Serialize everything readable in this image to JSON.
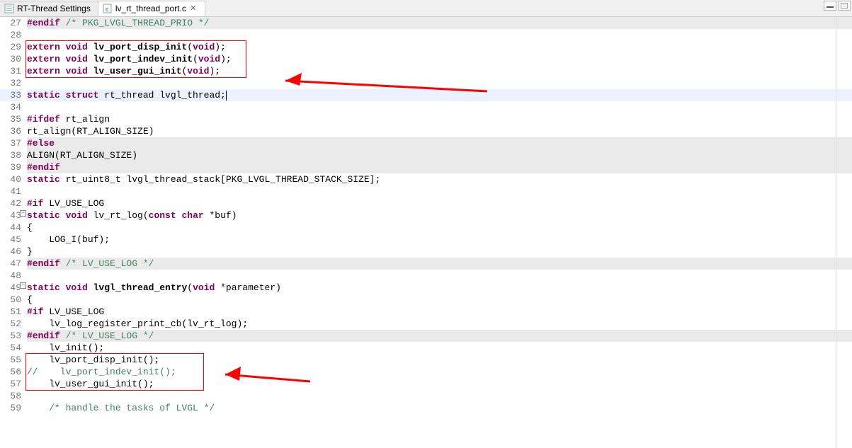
{
  "tabs": {
    "t0": {
      "label": "RT-Thread Settings"
    },
    "t1": {
      "label": "lv_rt_thread_port.c"
    }
  },
  "lineNumbers": [
    "27",
    "28",
    "29",
    "30",
    "31",
    "32",
    "33",
    "34",
    "35",
    "36",
    "37",
    "38",
    "39",
    "40",
    "41",
    "42",
    "43",
    "44",
    "45",
    "46",
    "47",
    "48",
    "49",
    "50",
    "51",
    "52",
    "53",
    "54",
    "55",
    "56",
    "57",
    "58",
    "59"
  ],
  "code": {
    "l27": {
      "a": "#endif",
      "b": " /* PKG_LVGL_THREAD_PRIO */"
    },
    "l29": {
      "a": "extern",
      "b": " void",
      "c": " lv_port_disp_init",
      "d": "(",
      "e": "void",
      "f": ");"
    },
    "l30": {
      "a": "extern",
      "b": " void",
      "c": " lv_port_indev_init",
      "d": "(",
      "e": "void",
      "f": ");"
    },
    "l31": {
      "a": "extern",
      "b": " void",
      "c": " lv_user_gui_init",
      "d": "(",
      "e": "void",
      "f": ");"
    },
    "l33": {
      "a": "static",
      "b": " struct",
      "c": " rt_thread lvgl_thread;"
    },
    "l35": {
      "a": "#ifdef",
      "b": " rt_align"
    },
    "l36": {
      "a": "rt_align(RT_ALIGN_SIZE)"
    },
    "l37": {
      "a": "#else"
    },
    "l38": {
      "a": "ALIGN(RT_ALIGN_SIZE)"
    },
    "l39": {
      "a": "#endif"
    },
    "l40": {
      "a": "static",
      "b": " rt_uint8_t lvgl_thread_stack[PKG_LVGL_THREAD_STACK_SIZE];"
    },
    "l42": {
      "a": "#if",
      "b": " LV_USE_LOG"
    },
    "l43": {
      "a": "static",
      "b": " void",
      "c": " lv_rt_log(",
      "d": "const",
      "e": " char",
      "f": " *buf)"
    },
    "l44": {
      "a": "{"
    },
    "l45": {
      "a": "    LOG_I(buf);"
    },
    "l46": {
      "a": "}"
    },
    "l47": {
      "a": "#endif",
      "b": " /* LV_USE_LOG */"
    },
    "l49": {
      "a": "static",
      "b": " void",
      "c": " lvgl_thread_entry",
      "d": "(",
      "e": "void",
      "f": " *parameter)"
    },
    "l50": {
      "a": "{"
    },
    "l51": {
      "a": "#if",
      "b": " LV_USE_LOG"
    },
    "l52": {
      "a": "    lv_log_register_print_cb(lv_rt_log);"
    },
    "l53": {
      "a": "#endif",
      "b": " /* LV_USE_LOG */"
    },
    "l54": {
      "a": "    lv_init();"
    },
    "l55": {
      "a": "    lv_port_disp_init();"
    },
    "l56": {
      "a": "//    lv_port_indev_init();"
    },
    "l57": {
      "a": "    lv_user_gui_init();"
    },
    "l59": {
      "a": "    /* handle the tasks of LVGL */"
    }
  }
}
